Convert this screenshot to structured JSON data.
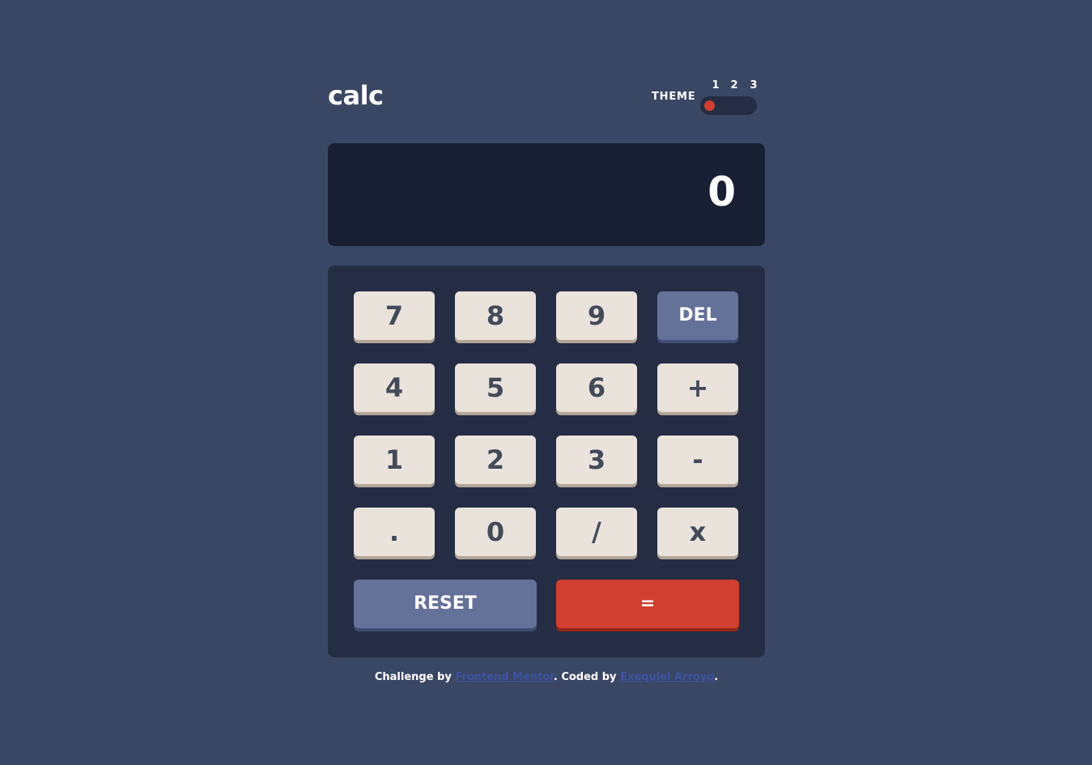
{
  "header": {
    "logo": "calc",
    "theme_label": "THEME",
    "theme_options": [
      "1",
      "2",
      "3"
    ],
    "active_theme": "1"
  },
  "screen": {
    "value": "0"
  },
  "keys": {
    "k7": "7",
    "k8": "8",
    "k9": "9",
    "del": "DEL",
    "k4": "4",
    "k5": "5",
    "k6": "6",
    "plus": "+",
    "k1": "1",
    "k2": "2",
    "k3": "3",
    "minus": "-",
    "dot": ".",
    "k0": "0",
    "divide": "/",
    "multiply": "x",
    "reset": "RESET",
    "equals": "="
  },
  "footer": {
    "challenge_prefix": "Challenge by ",
    "challenge_link": "Frontend Mentor",
    "coded_prefix": ". Coded by ",
    "coded_link": "Exequiel Arroyo",
    "suffix": "."
  },
  "colors": {
    "background": "#3a4764",
    "keypad": "#242d44",
    "screen": "#181f33",
    "key": "#eae3dc",
    "key_shadow": "#b3a497",
    "accent_blue": "#647198",
    "accent_red": "#d03f2f",
    "link": "#3e52a3"
  }
}
